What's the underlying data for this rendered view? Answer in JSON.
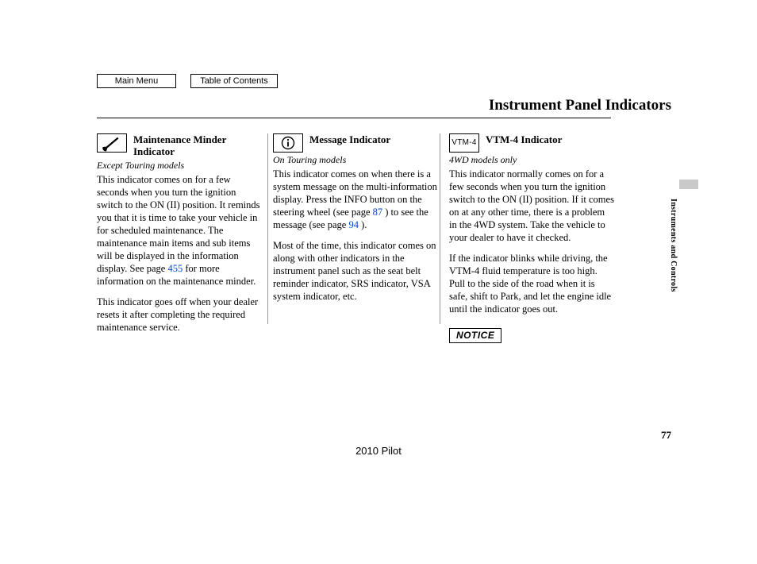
{
  "nav": {
    "main_menu": "Main Menu",
    "toc": "Table of Contents"
  },
  "page_title": "Instrument Panel Indicators",
  "side_tab": "Instruments and Controls",
  "columns": {
    "col1": {
      "icon_name": "wrench-icon",
      "heading": "Maintenance Minder Indicator",
      "subhead": "Except Touring models",
      "p1a": "This indicator comes on for a few seconds when you turn the ignition switch to the ON (II) position. It reminds you that it is time to take your vehicle in for scheduled maintenance. The maintenance main items and sub items will be displayed in the information display. See page ",
      "link1": "455",
      "p1b": " for more information on the maintenance minder.",
      "p2": "This indicator goes off when your dealer resets it after completing the required maintenance service."
    },
    "col2": {
      "icon_name": "info-icon",
      "heading": "Message Indicator",
      "subhead": "On Touring models",
      "p1a": "This indicator comes on when there is a system message on the multi-information display. Press the INFO button on the steering wheel (see page ",
      "link1": "87",
      "p1b": " ) to see the message (see page ",
      "link2": "94",
      "p1c": " ).",
      "p2": "Most of the time, this indicator comes on along with other indicators in the instrument panel such as the seat belt reminder indicator, SRS indicator, VSA system indicator, etc."
    },
    "col3": {
      "icon_label": "VTM-4",
      "heading": "VTM-4 Indicator",
      "subhead": "4WD models only",
      "p1": "This indicator normally comes on for a few seconds when you turn the ignition switch to the ON (II) position. If it comes on at any other time, there is a problem in the 4WD system. Take the vehicle to your dealer to have it checked.",
      "p2": "If the indicator blinks while driving, the VTM-4 fluid temperature is too high. Pull to the side of the road when it is safe, shift to Park, and let the engine idle until the indicator goes out.",
      "notice": "NOTICE"
    }
  },
  "page_number": "77",
  "footer_model": "2010 Pilot"
}
